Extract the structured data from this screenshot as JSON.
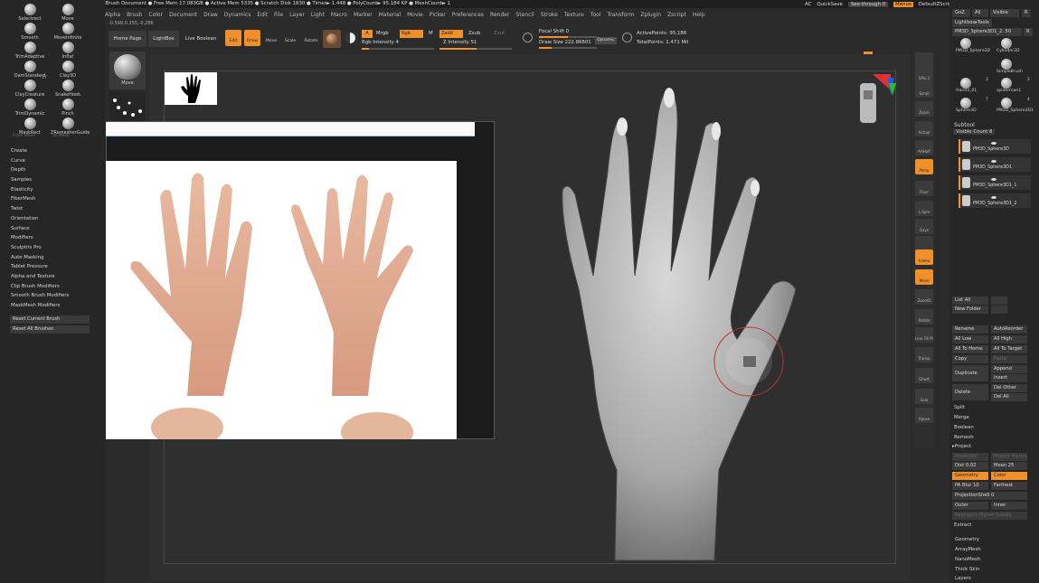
{
  "titlebar": {
    "text": "ZBrush 2021.7 [Canal de Mateus Pereira]   ZBrush Document    ● Free Mem 17.083GB ● Active Mem 5335 ● Scratch Disk 1830 ● Timer► 1.448 ● PolyCount► 95.184 KP ● MeshCount► 1"
  },
  "topright": {
    "ai": "AC",
    "quicksave": "QuickSave",
    "seethrough": "See-through  0",
    "menus": "Menus",
    "script": "DefaultZScript"
  },
  "menubar": [
    "Alpha",
    "Brush",
    "Color",
    "Document",
    "Draw",
    "Dynamics",
    "Edit",
    "File",
    "Layer",
    "Light",
    "Macro",
    "Marker",
    "Material",
    "Movie",
    "Picker",
    "Preferences",
    "Render",
    "Stencil",
    "Stroke",
    "Texture",
    "Tool",
    "Transform",
    "Zplugin",
    "Zscript",
    "Help"
  ],
  "coords": "-0.599,0.255,-0.286",
  "toolbar": {
    "home": "Home Page",
    "lightbox": "LightBox",
    "liveboolean": "Live Boolean",
    "edit": "Edit",
    "draw": "Draw",
    "move": "Move",
    "scale": "Scale",
    "rotate": "Rotate",
    "a": "A",
    "mrgb": "Mrgb",
    "rgb": "Rgb",
    "m": "M",
    "zadd": "Zadd",
    "zsub": "Zsub",
    "zcut": "Zcut",
    "rgb_intensity": "Rgb Intensity 4",
    "z_intensity": "Z Intensity 51",
    "focal_shift": "Focal Shift 0",
    "draw_size": "Draw Size 222.86801",
    "dynamic": "Dynamic",
    "active_points": "ActivePoints: 95,186",
    "total_points": "TotalPoints: 1.471 Mil",
    "rgb_intensity_level": 0.1,
    "z_intensity_level": 0.51,
    "focal_shift_level": 0.5,
    "draw_size_level": 0.22
  },
  "brushes": [
    {
      "label": "Selectrect"
    },
    {
      "label": "Move"
    },
    {
      "label": "Smooth"
    },
    {
      "label": "MoveInfinite"
    },
    {
      "label": "TrimAdaptive"
    },
    {
      "label": "Inflat"
    },
    {
      "label": "DamStandard"
    },
    {
      "label": "Clay3D"
    },
    {
      "label": "ClayCreature"
    },
    {
      "label": "SnakeHook"
    },
    {
      "label": "TrimDynamic"
    },
    {
      "label": "Pinch"
    },
    {
      "label": "MaskRect"
    },
    {
      "label": "ZRemesherGuide"
    }
  ],
  "brush_counts": {
    "clay3d": "17",
    "claycreature": "17"
  },
  "brush_subtabs": {
    "frontmask": "From Mesh",
    "tomesh": "To Mesh"
  },
  "left_menu": [
    "Create",
    "Curve",
    "Depth",
    "Samples",
    "Elasticity",
    "FiberMesh",
    "Twist",
    "Orientation",
    "Surface",
    "Modifiers",
    "Sculptris Pro",
    "Auto Masking",
    "Tablet Pressure",
    "Alpha and Texture",
    "Clip Brush Modifiers",
    "Smooth Brush Modifiers",
    "MaskMesh Modifiers"
  ],
  "left_buttons": {
    "reset_current": "Reset Current Brush",
    "reset_all": "Reset All Brushes"
  },
  "stroke_thumb": {
    "move": "Move"
  },
  "right_shelf": [
    "",
    "SPix 3",
    "Scroll",
    "Zoom",
    "Actual",
    "AAHalf",
    "Persp",
    "Floor",
    "L.Sym",
    "Gxyz",
    "",
    "Frame",
    "Move",
    "ZoomD",
    "Rotate",
    "Line Fill PolyF",
    "Transp",
    "Ghost",
    "Solo",
    "Xpose"
  ],
  "right_panel": {
    "top": {
      "goz": "GoZ",
      "all": "All",
      "visible": "Visible",
      "r": "R"
    },
    "lightbox_tools": "Lightbox▸Tools",
    "current_tool": "PM3D_Sphere3D1_2. 50",
    "r2": "R",
    "tools": [
      {
        "label": "PM3D_Sphere3D"
      },
      {
        "label": "Cylinder3D"
      },
      {
        "label": "SimpleBrush"
      },
      {
        "label": "Hand3_01"
      },
      {
        "label": "spiderman1"
      },
      {
        "label": "Sphere3D"
      },
      {
        "label": "PM3D_Sphere3D1"
      }
    ],
    "tool_counts": {
      "a": "2",
      "b": "3",
      "c": "7",
      "d": "4"
    },
    "subtool": "Subtool",
    "visible_count": "Visible Count 8",
    "subtools": [
      "PM3D_Sphere3D",
      "PM3D_Sphere3D1",
      "PM3D_Sphere3D1_1",
      "PM3D_Sphere3D1_2"
    ],
    "list_all": "List All",
    "new_folder": "New Folder",
    "rename": "Rename",
    "autoreorder": "AutoReorder",
    "all_low": "All Low",
    "all_high": "All High",
    "all_to_home": "All To Home",
    "all_to_target": "All To Target",
    "copy": "Copy",
    "paste": "Paste",
    "duplicate": "Duplicate",
    "append": "Append",
    "insert": "Insert",
    "delete": "Delete",
    "del_other": "Del Other",
    "del_all": "Del All",
    "split": "Split",
    "merge": "Merge",
    "boolean": "Boolean",
    "remesh": "Remesh",
    "project": "▸Project",
    "project_all": "ProjectAll",
    "project_history": "Project History",
    "dist": "Dist 0.02",
    "mean": "Mean 25",
    "geometry_btn": "Geometry",
    "color_btn": "Color",
    "pa_blur": "PA Blur 10",
    "farthest": "Farthest",
    "projection_shell": "ProjectionShell 0",
    "outer": "Outer",
    "inner": "Inner",
    "reproject": "Reproject Higher Subdiv",
    "extract": "Extract",
    "geometry": "Geometry",
    "arraymesh": "ArrayMesh",
    "nanomesh": "NanoMesh",
    "thickskin": "Thick Skin",
    "layers": "Layers"
  },
  "colors": {
    "accent": "#f0902a",
    "bg": "#2b2b2b",
    "panel": "#262626"
  }
}
